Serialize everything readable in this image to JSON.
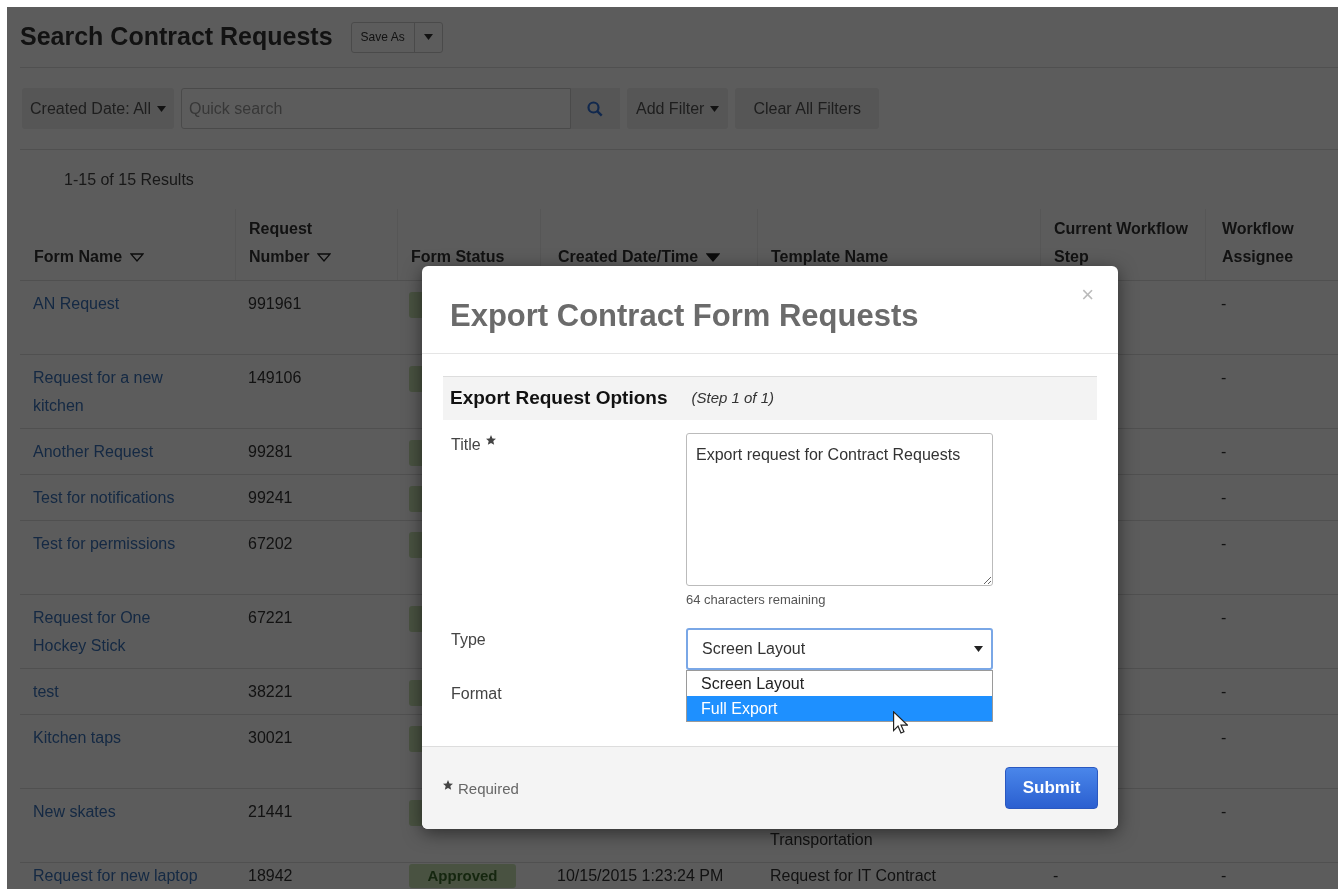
{
  "page": {
    "title": "Search Contract Requests",
    "save_as": "Save As"
  },
  "filters": {
    "date_filter": "Created Date: All",
    "search_placeholder": "Quick search",
    "add_filter": "Add Filter",
    "clear_filters": "Clear All Filters"
  },
  "results_count": "1-15 of 15 Results",
  "table": {
    "columns": [
      {
        "label": "Form Name",
        "sorted": false
      },
      {
        "label": "Request Number",
        "sorted": false
      },
      {
        "label": "Form Status"
      },
      {
        "label": "Created Date/Time",
        "sorted": true
      },
      {
        "label": "Template Name"
      },
      {
        "label": "Current Workflow Step"
      },
      {
        "label": "Workflow Assignee"
      }
    ],
    "rows": [
      {
        "kind": "tall",
        "form_name": "AN Request",
        "request_number": "991961",
        "workflow_assignee": "-"
      },
      {
        "kind": "tall",
        "form_name": "Request for a new kitchen",
        "request_number": "149106",
        "workflow_assignee": "-"
      },
      {
        "kind": "short",
        "form_name": "Another Request",
        "request_number": "99281",
        "workflow_assignee": "-"
      },
      {
        "kind": "short",
        "form_name": "Test for notifications",
        "request_number": "99241",
        "workflow_assignee": "-"
      },
      {
        "kind": "tall",
        "form_name": "Test for permissions",
        "request_number": "67202",
        "workflow_assignee": "-"
      },
      {
        "kind": "tall",
        "form_name": "Request for One Hockey Stick",
        "request_number": "67221",
        "workflow_assignee": "-"
      },
      {
        "kind": "short",
        "form_name": "test",
        "request_number": "38221",
        "workflow_assignee": "-"
      },
      {
        "kind": "tall",
        "form_name": "Kitchen taps",
        "request_number": "30021",
        "workflow_assignee": "-"
      },
      {
        "kind": "tall",
        "form_name": "New skates",
        "request_number": "21441",
        "template_name": "Transportation",
        "workflow_assignee": "-"
      },
      {
        "kind": "edge",
        "form_name": "Request for new laptop",
        "request_number": "18942",
        "status": "Approved",
        "created": "10/15/2015 1:23:24 PM",
        "template_name": "Request for IT Contract",
        "current_step": "-",
        "workflow_assignee": "-"
      }
    ]
  },
  "modal": {
    "title": "Export Contract Form Requests",
    "close": "×",
    "section_title": "Export Request Options",
    "section_step": "(Step 1 of 1)",
    "fields": [
      {
        "kind": "textarea",
        "label": "Title",
        "required": true,
        "value": "Export request for Contract Requests",
        "hint": "64 characters remaining"
      },
      {
        "kind": "select",
        "label": "Type",
        "value": "Screen Layout",
        "expanded": true,
        "options": [
          {
            "label": "Screen Layout",
            "highlighted": false
          },
          {
            "label": "Full Export",
            "highlighted": true
          }
        ]
      },
      {
        "kind": "label_only",
        "label": "Format"
      }
    ],
    "required_note": "Required",
    "submit": "Submit"
  }
}
